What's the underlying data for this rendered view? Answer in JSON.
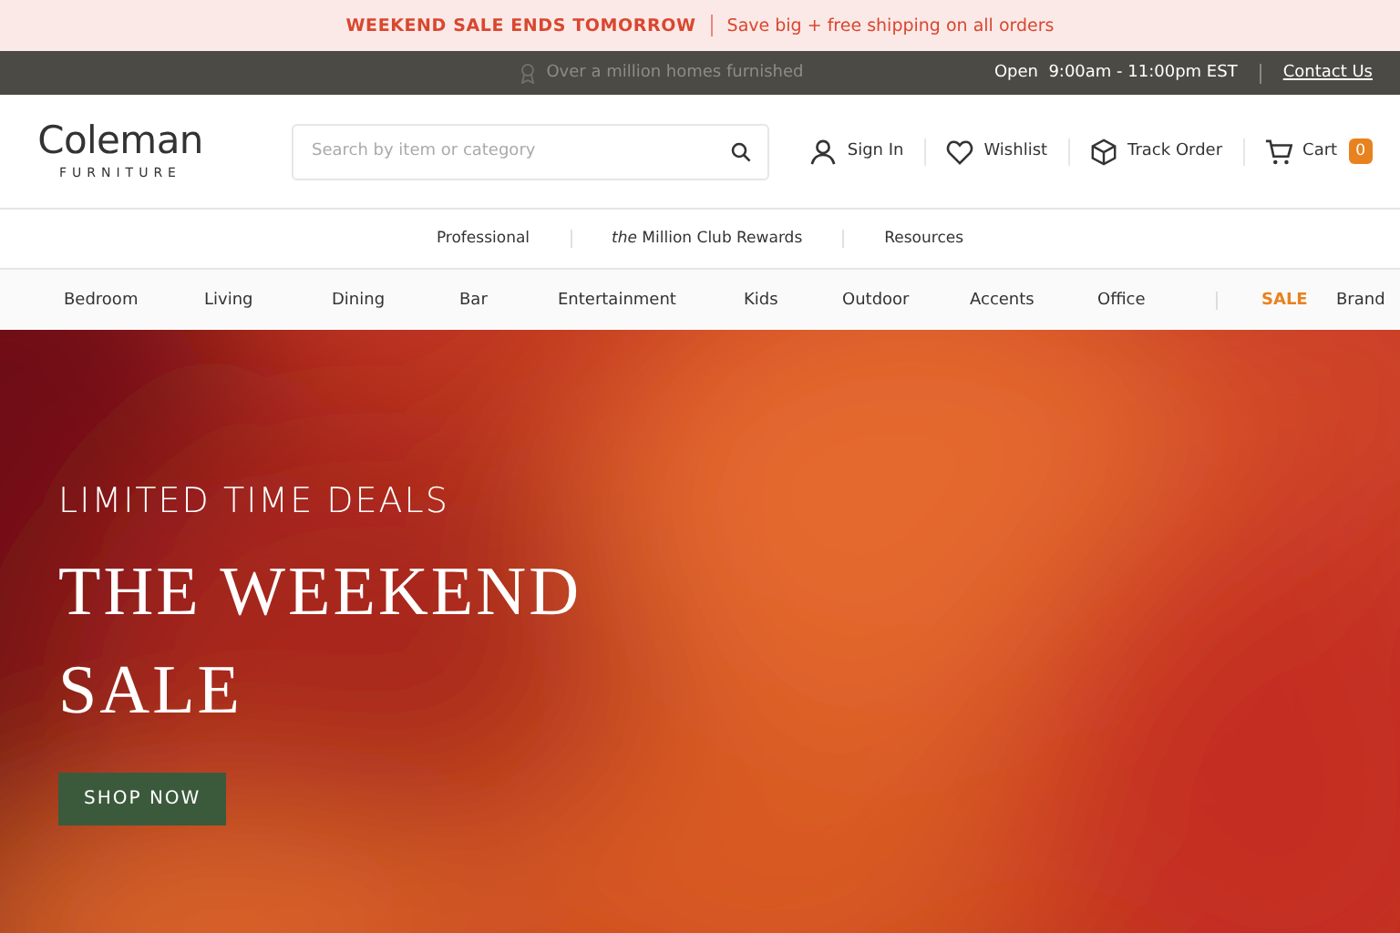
{
  "promo_bar": {
    "headline": "WEEKEND SALE ENDS TOMORROW",
    "message": "Save big + free shipping on all orders"
  },
  "info_bar": {
    "tagline": "Over a million homes furnished",
    "hours": "Open  9:00am - 11:00pm EST",
    "contact_link": "Contact Us"
  },
  "header": {
    "logo": {
      "name": "Coleman",
      "subtitle": "FURNITURE"
    },
    "search": {
      "placeholder": "Search by item or category"
    },
    "actions": [
      {
        "kind": "user",
        "label": "Sign In"
      },
      {
        "kind": "heart",
        "label": "Wishlist"
      },
      {
        "kind": "box",
        "label": "Track Order"
      },
      {
        "kind": "cart",
        "label": "Cart",
        "badge": "0"
      }
    ]
  },
  "secondary_nav": [
    "Professional",
    "*the* Million Club Rewards",
    "Resources"
  ],
  "category_nav": [
    {
      "label": "Bedroom",
      "kind": "normal"
    },
    {
      "label": "Living",
      "kind": "normal"
    },
    {
      "label": "Dining",
      "kind": "normal"
    },
    {
      "label": "Bar",
      "kind": "normal"
    },
    {
      "label": "Entertainment",
      "kind": "normal"
    },
    {
      "label": "Kids",
      "kind": "normal"
    },
    {
      "label": "Outdoor",
      "kind": "normal"
    },
    {
      "label": "Accents",
      "kind": "normal"
    },
    {
      "label": "Office",
      "kind": "normal"
    },
    {
      "label": "SALE",
      "kind": "sale"
    },
    {
      "label": "Brand",
      "kind": "normal"
    }
  ],
  "hero": {
    "eyebrow": "LIMITED TIME DEALS",
    "title": "THE WEEKEND SALE",
    "button": "SHOP NOW"
  }
}
